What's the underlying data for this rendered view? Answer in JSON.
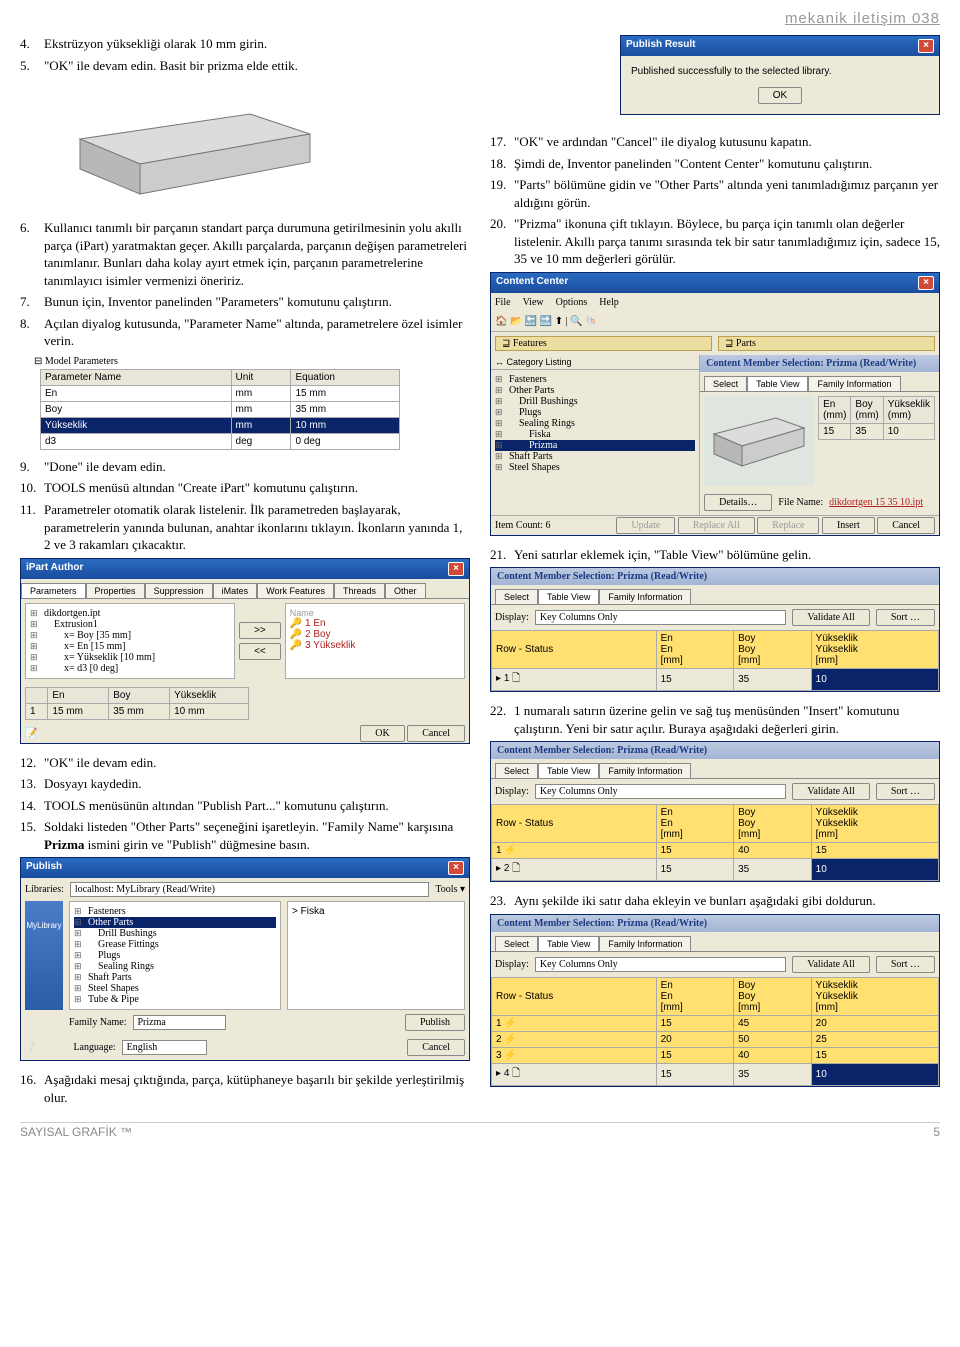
{
  "header": "mekanik iletişim 038",
  "left": {
    "i4": "Ekstrüzyon yüksekliği olarak 10 mm girin.",
    "i5": "\"OK\" ile devam edin. Basit bir prizma elde ettik.",
    "i6": "Kullanıcı tanımlı bir parçanın standart parça durumuna getirilmesinin yolu akıllı parça (iPart) yaratmaktan geçer. Akıllı parçalarda, parçanın değişen parametreleri tanımlanır. Bunları daha kolay ayırt etmek için, parçanın parametrelerine tanımlayıcı isimler vermenizi öneririz.",
    "i7": "Bunun için, Inventor panelinden \"Parameters\" komutunu çalıştırın.",
    "i8": "Açılan diyalog kutusunda, \"Parameter Name\" altında, parametrelere özel isimler verin.",
    "modelp_title": "Model Parameters",
    "pt_h": [
      "Parameter Name",
      "Unit",
      "Equation"
    ],
    "pt_rows": [
      [
        "En",
        "mm",
        "15 mm"
      ],
      [
        "Boy",
        "mm",
        "35 mm"
      ],
      [
        "Yükseklik",
        "mm",
        "10 mm"
      ],
      [
        "d3",
        "deg",
        "0 deg"
      ]
    ],
    "i9": "\"Done\" ile devam edin.",
    "i10": "TOOLS menüsü altından \"Create iPart\" komutunu çalıştırın.",
    "i11": "Parametreler otomatik olarak listelenir. İlk parametreden başlayarak, parametrelerin yanında bulunan, anahtar ikonlarını tıklayın. İkonların yanında 1, 2 ve 3 rakamları çıkacaktır.",
    "ipart_title": "iPart Author",
    "ipart_tabs": [
      "Parameters",
      "Properties",
      "Suppression",
      "iMates",
      "Work Features",
      "Threads",
      "Other"
    ],
    "ipart_tree": [
      "dikdortgen.ipt",
      "Extrusion1",
      "x= Boy [35 mm]",
      "x= En [15 mm]",
      "x= Yükseklik [10 mm]",
      "x= d3 [0 deg]"
    ],
    "ipart_names": [
      "En",
      "Boy",
      "Yükseklik"
    ],
    "ipart_tbl_hdr": [
      "",
      "En",
      "Boy",
      "Yükseklik"
    ],
    "ipart_tbl_row": [
      "1",
      "15 mm",
      "35 mm",
      "10 mm"
    ],
    "btn_ok": "OK",
    "btn_cancel": "Cancel",
    "i12": "\"OK\" ile devam edin.",
    "i13": "Dosyayı kaydedin.",
    "i14": "TOOLS menüsünün altından \"Publish Part...\" komutunu çalıştırın.",
    "i15a": "Soldaki listeden \"Other Parts\" seçeneğini işaretleyin. \"Family Name\" karşısına ",
    "i15b": "Prizma",
    "i15c": " ismini girin ve \"Publish\" düğmesine basın.",
    "pub_title": "Publish",
    "pub_lib_lbl": "Libraries:",
    "pub_lib_val": "localhost: MyLibrary (Read/Write)",
    "pub_tools": "Tools ▾",
    "pub_tree": [
      "Fasteners",
      "Other Parts",
      "Drill Bushings",
      "Grease Fittings",
      "Plugs",
      "Sealing Rings",
      "Shaft Parts",
      "Steel Shapes",
      "Tube & Pipe"
    ],
    "pub_fam_lbl": "Family Name:",
    "pub_fam_val": "Prizma",
    "pub_lang_lbl": "Language:",
    "pub_lang_val": "English",
    "pub_btn_pub": "Publish",
    "pub_btn_cancel": "Cancel",
    "pub_right": "Fiska",
    "i16": "Aşağıdaki mesaj çıktığında, parça, kütüphaneye başarılı bir şekilde yerleştirilmiş olur."
  },
  "right": {
    "pr_title": "Publish Result",
    "pr_msg": "Published successfully to the selected library.",
    "pr_ok": "OK",
    "i17": "\"OK\" ve ardından \"Cancel\" ile diyalog kutusunu kapatın.",
    "i18": "Şimdi de, Inventor panelinden \"Content Center\" komutunu çalıştırın.",
    "i19": "\"Parts\" bölümüne gidin ve \"Other Parts\" altında yeni tanımladığımız parçanın yer aldığını görün.",
    "i20": "\"Prizma\" ikonuna çift tıklayın. Böylece, bu parça için tanımlı olan değerler listelenir. Akıllı parça tanımı sırasında tek bir satır tanımladığımız için, sadece 15, 35 ve 10 mm değerleri görülür.",
    "cc_title": "Content Center",
    "cc_menu": [
      "File",
      "View",
      "Options",
      "Help"
    ],
    "cc_feat": "Features",
    "cc_parts": "Parts",
    "cc_catlist": "Category Listing",
    "cc_cats": [
      "Fasteners",
      "Other Parts",
      "Drill Bushings",
      "Plugs",
      "Sealing Rings",
      "Fiska",
      "Prizma",
      "Shaft Parts",
      "Steel Shapes"
    ],
    "cm_title": "Content Member Selection: Prizma (Read/Write)",
    "cm_tabs": [
      "Select",
      "Table View",
      "Family Information"
    ],
    "cm_hdr": [
      "En (mm)",
      "Boy (mm)",
      "Yükseklik (mm)"
    ],
    "cm_row": [
      "15",
      "35",
      "10"
    ],
    "cm_file_lbl": "File Name:",
    "cm_file_val": "dikdortgen 15 35 10.ipt",
    "cm_count": "Item Count: 6",
    "cm_btns": [
      "Details…",
      "Update",
      "Replace All",
      "Replace",
      "Insert",
      "Cancel"
    ],
    "i21": "Yeni satırlar eklemek için, \"Table View\" bölümüne gelin.",
    "tv_disp_lbl": "Display:",
    "tv_disp_val": "Key Columns Only",
    "tv_val": "Validate All",
    "tv_sort": "Sort …",
    "tv1_hdr_row": [
      "Row - Status",
      "En\nEn\n[mm]",
      "Boy\nBoy\n[mm]",
      "Yükseklik\nYükseklik\n[mm]"
    ],
    "tv1_row": [
      "1",
      "15",
      "35",
      "10"
    ],
    "i22": "1 numaralı satırın üzerine gelin ve sağ tuş menüsünden \"Insert\" komutunu çalıştırın. Yeni bir satır açılır. Buraya aşağıdaki değerleri girin.",
    "tv2_rows": [
      [
        "1",
        "15",
        "40",
        "15"
      ],
      [
        "2",
        "15",
        "35",
        "10"
      ]
    ],
    "i23": "Aynı şekilde iki satır daha ekleyin ve bunları aşağıdaki gibi doldurun.",
    "tv3_rows": [
      [
        "1",
        "15",
        "45",
        "20"
      ],
      [
        "2",
        "20",
        "50",
        "25"
      ],
      [
        "3",
        "15",
        "40",
        "15"
      ],
      [
        "4",
        "15",
        "35",
        "10"
      ]
    ]
  },
  "footer_left": "SAYISAL GRAFİK ™",
  "footer_right": "5"
}
